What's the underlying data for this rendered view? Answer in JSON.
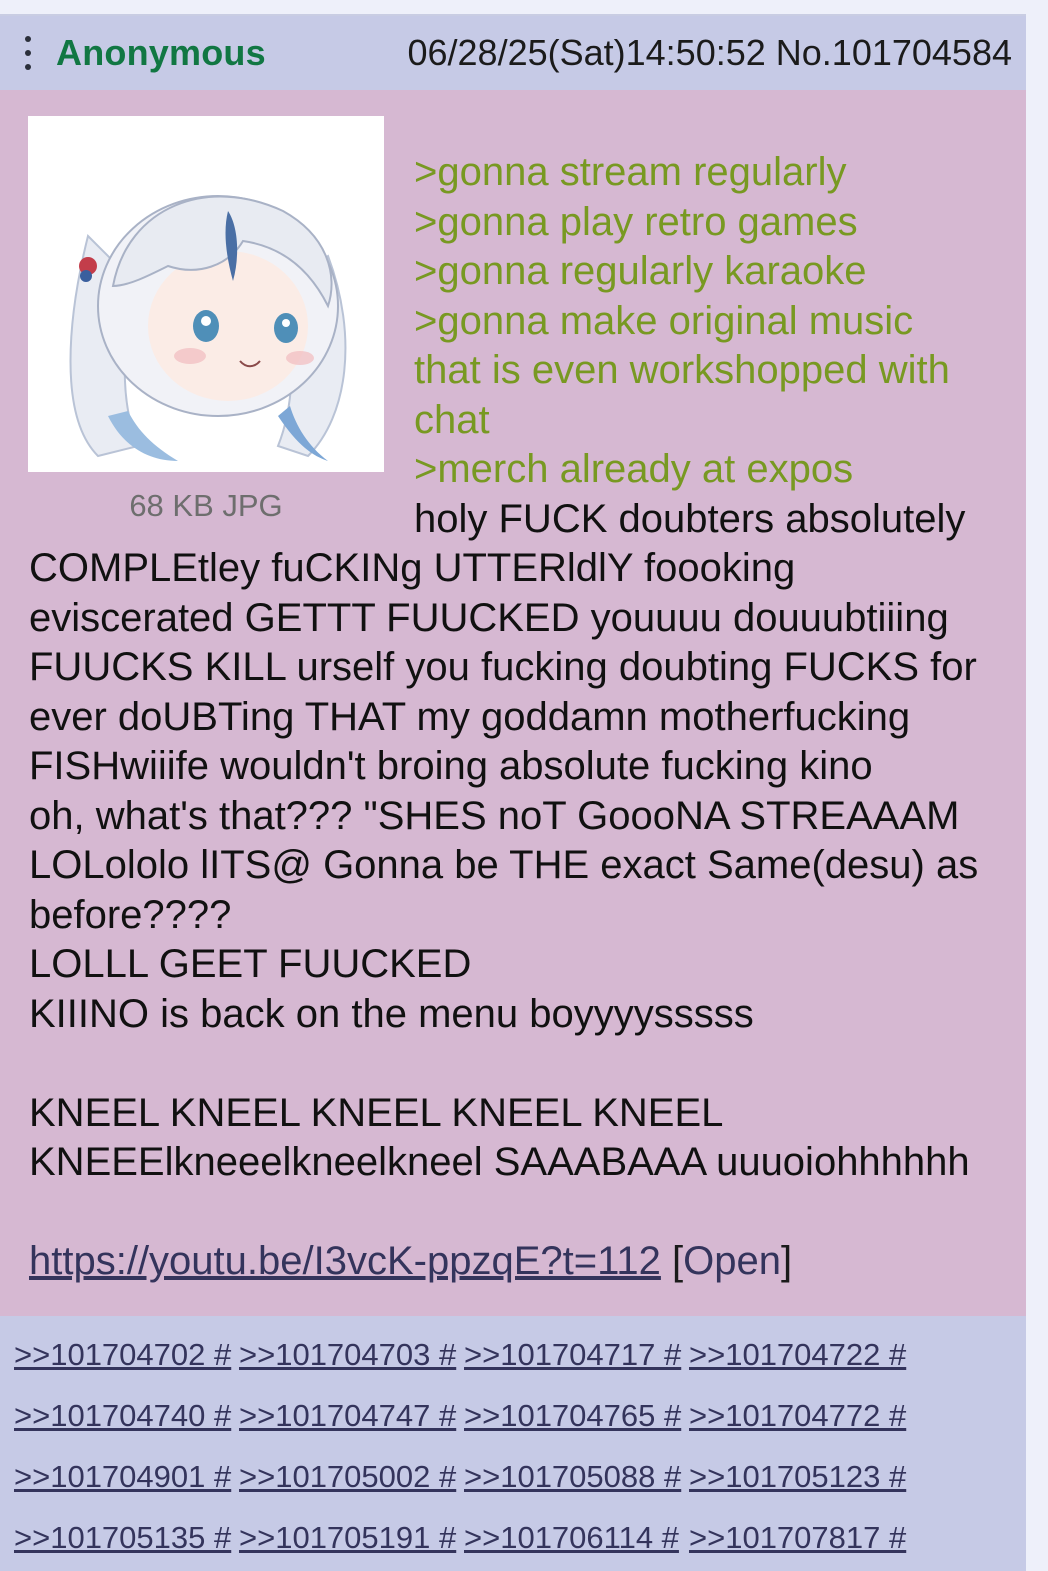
{
  "post": {
    "name": "Anonymous",
    "datetime": "06/28/25(Sat)14:50:52",
    "number": "No.101704584",
    "file_info": "68 KB JPG",
    "greentext": [
      ">gonna stream regularly",
      ">gonna play retro games",
      ">gonna regularly karaoke",
      ">gonna make original music",
      "that is even workshopped with",
      "chat",
      ">merch already at expos"
    ],
    "body_first_line": "holy FUCK doubters absolutely",
    "body_lines": [
      "COMPLEtley fuCKINg UTTERldlY foooking",
      "eviscerated GETTT FUUCKED youuuu douuubtiiing",
      "FUUCKS KILL urself you fucking doubting FUCKS for",
      "ever doUBTing THAT my goddamn motherfucking",
      "FISHwiiife wouldn't broing absolute fucking kino",
      "oh, what's that??? \"SHES noT GoooNA STREAAAM",
      "LOLololo lITS@ Gonna be THE exact Same(desu) as",
      "before????",
      "LOLLL GEET FUUCKED",
      "KIIINO is back on the menu boyyyysssss",
      "",
      "KNEEL KNEEL KNEEL KNEEL KNEEL",
      "KNEEElkneeelkneelkneel SAAABAAA uuuoiohhhhhh"
    ],
    "link_url": "https://youtu.be/I3vcK-ppzqE?t=112",
    "open_label": "Open",
    "bracket_open": "[",
    "bracket_close": "]"
  },
  "replies": [
    ">>101704702 #",
    ">>101704703 #",
    ">>101704717 #",
    ">>101704722 #",
    ">>101704740 #",
    ">>101704747 #",
    ">>101704765 #",
    ">>101704772 #",
    ">>101704901 #",
    ">>101705002 #",
    ">>101705088 #",
    ">>101705123 #",
    ">>101705135 #",
    ">>101705191 #",
    ">>101706114 #",
    ">>101707817 #"
  ],
  "colors": {
    "post_bg": "#d6b8d2",
    "header_bg": "#c6cae6",
    "name": "#117743",
    "greentext": "#789922",
    "link": "#34345c"
  }
}
